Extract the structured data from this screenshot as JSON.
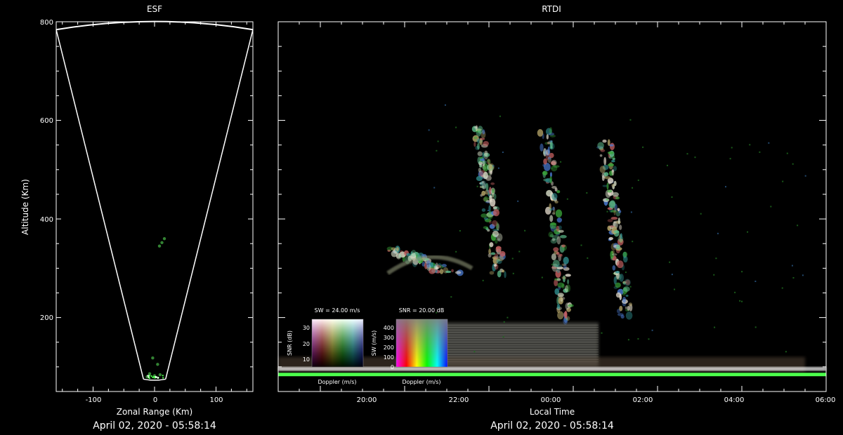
{
  "chart_data": [
    {
      "type": "scatter",
      "title": "ESF",
      "xlabel": "Zonal Range (Km)",
      "ylabel": "Altitude (Km)",
      "timestamp": "April 02, 2020 - 05:58:14",
      "xlim": [
        -160,
        160
      ],
      "ylim": [
        50,
        800
      ],
      "xticks": [
        "-100",
        "0",
        "100"
      ],
      "yticks": [
        "200",
        "400",
        "600",
        "800"
      ],
      "fan_edges": {
        "left_bottom": [
          -18,
          75
        ],
        "right_bottom": [
          18,
          75
        ],
        "left_top": [
          -160,
          784
        ],
        "right_top": [
          160,
          784
        ],
        "apex_top": [
          0,
          800
        ]
      },
      "echoes": [
        {
          "x": 12,
          "y": 352
        },
        {
          "x": 8,
          "y": 345
        },
        {
          "x": 16,
          "y": 360
        },
        {
          "x": -3,
          "y": 118
        },
        {
          "x": 5,
          "y": 105
        },
        {
          "x": -8,
          "y": 86
        },
        {
          "x": 0,
          "y": 82
        },
        {
          "x": 9,
          "y": 84
        },
        {
          "x": -12,
          "y": 80
        }
      ]
    },
    {
      "type": "heatmap",
      "title": "RTDI",
      "xlabel": "Local Time",
      "timestamp": "April 02, 2020 - 05:58:14",
      "xlim": [
        17,
        30
      ],
      "ylim": [
        50,
        800
      ],
      "xticks": [
        "20:00",
        "22:00",
        "00:00",
        "02:00",
        "04:00",
        "06:00"
      ],
      "plumes": [
        {
          "t0": 21.6,
          "t1": 22.4,
          "y0": 280,
          "y1": 590
        },
        {
          "t0": 23.2,
          "t1": 24.0,
          "y0": 190,
          "y1": 580
        },
        {
          "t0": 24.6,
          "t1": 25.4,
          "y0": 200,
          "y1": 560
        },
        {
          "t0": 19.6,
          "t1": 21.2,
          "y0": 290,
          "y1": 340
        }
      ],
      "bottom_band": {
        "y": 85,
        "color": "#4cff4c"
      },
      "legends": [
        {
          "title": "SW = 24.00 m/s",
          "xlabel": "Doppler (m/s)",
          "ylabel": "SNR (dB)",
          "yticks": [
            "10",
            "20",
            "30"
          ]
        },
        {
          "title": "SNR = 20.00 dB",
          "xlabel": "Doppler (m/s)",
          "ylabel": "SW (m/s)",
          "yticks": [
            "0",
            "100",
            "200",
            "300",
            "400"
          ]
        }
      ]
    }
  ]
}
